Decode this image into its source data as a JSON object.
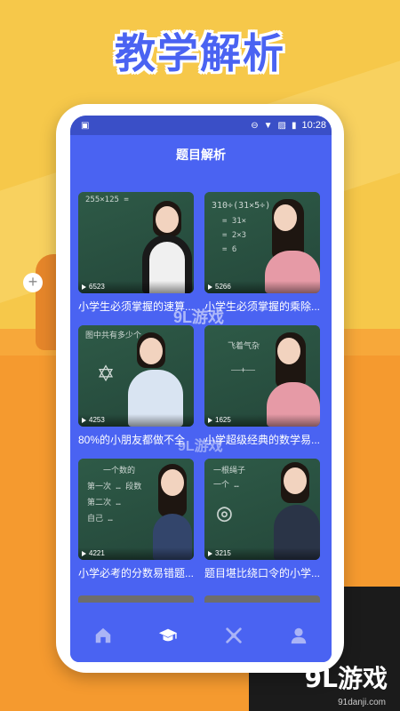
{
  "headline": "教学解析",
  "status": {
    "time": "10:28"
  },
  "appbar": {
    "title": "题目解析"
  },
  "videos": [
    {
      "views": "6523",
      "title": "小学生必须掌握的速算..."
    },
    {
      "views": "5266",
      "title": "小学生必须掌握的乘除..."
    },
    {
      "views": "4253",
      "title": "80%的小朋友都做不全"
    },
    {
      "views": "1625",
      "title": "小学超级经典的数学易..."
    },
    {
      "views": "4221",
      "title": "小学必考的分数易错题..."
    },
    {
      "views": "3215",
      "title": "题目堪比绕口令的小学..."
    }
  ],
  "chalk": [
    "255×125 =",
    "310÷(31×5÷)",
    "图中共有多少个",
    "飞着气杂",
    "一个数的",
    "一根绳子"
  ],
  "tabs": [
    {
      "name": "home",
      "icon": "home-icon"
    },
    {
      "name": "study",
      "icon": "graduation-cap-icon"
    },
    {
      "name": "tools",
      "icon": "tools-icon"
    },
    {
      "name": "profile",
      "icon": "user-icon"
    }
  ],
  "watermark": {
    "a": "9L游戏",
    "b": "9L游戏"
  },
  "brand": {
    "name": "9L游戏",
    "url": "91danji.com"
  },
  "colors": {
    "primary": "#4a63f2",
    "background": "#f6c84a",
    "orange": "#f59a2f"
  }
}
